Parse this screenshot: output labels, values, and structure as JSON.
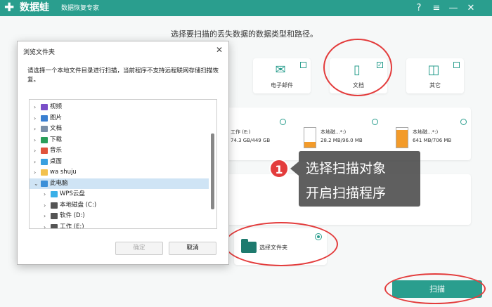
{
  "app": {
    "brand": "数据蛙",
    "slogan": "数据恢复专家"
  },
  "window_controls": {
    "help": "?",
    "menu": "≡",
    "minimize": "—",
    "close": "✕"
  },
  "main": {
    "instruction": "选择要扫描的丢失数据的数据类型和路径。"
  },
  "file_types": [
    {
      "label": "电子邮件",
      "icon": "mail-icon",
      "checked": false
    },
    {
      "label": "文档",
      "icon": "document-icon",
      "checked": true
    },
    {
      "label": "其它",
      "icon": "other-icon",
      "checked": false
    }
  ],
  "drives": [
    {
      "name": "工作 (E:)",
      "size": "74.3 GB/449 GB",
      "fill": 0.17
    },
    {
      "name": "本地磁...*:)",
      "size": "28.2 MB/96.0 MB",
      "fill": 0.29
    },
    {
      "name": "本地磁...*:)",
      "size": "641 MB/706 MB",
      "fill": 0.91
    }
  ],
  "folder_option": {
    "label": "选择文件夹",
    "selected": true
  },
  "scan_button": "扫描",
  "callout": {
    "step": "1",
    "line1": "选择扫描对象",
    "line2": "开启扫描程序"
  },
  "dialog": {
    "title": "浏览文件夹",
    "close": "✕",
    "description": "请选择一个本地文件目录进行扫描，当前程序不支持远程联网存储扫描恢复。",
    "tree": [
      {
        "label": "视频",
        "indent": 0,
        "icon": "video-icon",
        "color": "#7a4fc8"
      },
      {
        "label": "图片",
        "indent": 0,
        "icon": "pictures-icon",
        "color": "#3a7fd1"
      },
      {
        "label": "文档",
        "indent": 0,
        "icon": "documents-icon",
        "color": "#7a8fa8"
      },
      {
        "label": "下载",
        "indent": 0,
        "icon": "download-icon",
        "color": "#2a9e5a"
      },
      {
        "label": "音乐",
        "indent": 0,
        "icon": "music-icon",
        "color": "#e0533c"
      },
      {
        "label": "桌面",
        "indent": 0,
        "icon": "desktop-icon",
        "color": "#3aa0e0"
      },
      {
        "label": "wa shuju",
        "indent": 0,
        "icon": "folder-icon",
        "color": "#f2c14e"
      },
      {
        "label": "此电脑",
        "indent": 0,
        "icon": "computer-icon",
        "color": "#3a8fd8",
        "selected": true,
        "expanded": true
      },
      {
        "label": "WPS云盘",
        "indent": 1,
        "icon": "cloud-icon",
        "color": "#3ab0e8"
      },
      {
        "label": "本地磁盘 (C:)",
        "indent": 1,
        "icon": "drive-icon",
        "color": "#555555"
      },
      {
        "label": "软件 (D:)",
        "indent": 1,
        "icon": "drive-icon",
        "color": "#555555"
      },
      {
        "label": "工作 (E:)",
        "indent": 1,
        "icon": "drive-icon",
        "color": "#555555"
      }
    ],
    "ok_button": "确定",
    "cancel_button": "取消"
  },
  "colors": {
    "accent": "#2a9e8e",
    "annotation": "#e33c3c",
    "drive_fill": "#f39b2a"
  }
}
